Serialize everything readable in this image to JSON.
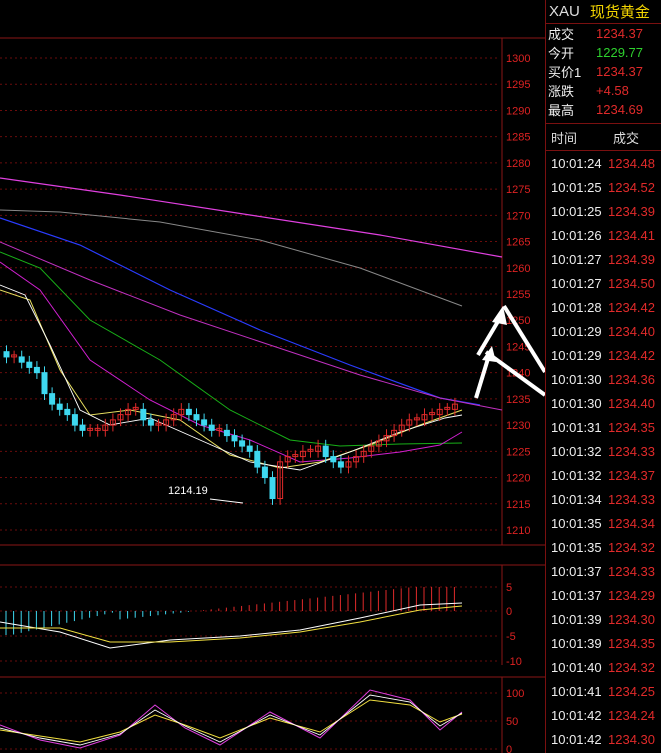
{
  "header": {
    "symbol": "XAU",
    "name": "现货黄金"
  },
  "quote": [
    {
      "label": "成交",
      "value": "1234.37",
      "color": "#e02a2a"
    },
    {
      "label": "今开",
      "value": "1229.77",
      "color": "#2ed12e"
    },
    {
      "label": "买价1",
      "value": "1234.37",
      "color": "#e02a2a"
    },
    {
      "label": "涨跌",
      "value": "+4.58",
      "color": "#e02a2a"
    },
    {
      "label": "最高",
      "value": "1234.69",
      "color": "#e02a2a"
    }
  ],
  "ticks_header": {
    "time": "时间",
    "price": "成交"
  },
  "ticks": [
    {
      "time": "10:01:24",
      "price": "1234.48"
    },
    {
      "time": "10:01:25",
      "price": "1234.52"
    },
    {
      "time": "10:01:25",
      "price": "1234.39"
    },
    {
      "time": "10:01:26",
      "price": "1234.41"
    },
    {
      "time": "10:01:27",
      "price": "1234.39"
    },
    {
      "time": "10:01:27",
      "price": "1234.50"
    },
    {
      "time": "10:01:28",
      "price": "1234.42"
    },
    {
      "time": "10:01:29",
      "price": "1234.40"
    },
    {
      "time": "10:01:29",
      "price": "1234.42"
    },
    {
      "time": "10:01:30",
      "price": "1234.36"
    },
    {
      "time": "10:01:30",
      "price": "1234.40"
    },
    {
      "time": "10:01:31",
      "price": "1234.35"
    },
    {
      "time": "10:01:32",
      "price": "1234.33"
    },
    {
      "time": "10:01:32",
      "price": "1234.37"
    },
    {
      "time": "10:01:34",
      "price": "1234.33"
    },
    {
      "time": "10:01:35",
      "price": "1234.34"
    },
    {
      "time": "10:01:35",
      "price": "1234.32"
    },
    {
      "time": "10:01:37",
      "price": "1234.33"
    },
    {
      "time": "10:01:37",
      "price": "1234.29"
    },
    {
      "time": "10:01:39",
      "price": "1234.30"
    },
    {
      "time": "10:01:39",
      "price": "1234.35"
    },
    {
      "time": "10:01:40",
      "price": "1234.32"
    },
    {
      "time": "10:01:41",
      "price": "1234.25"
    },
    {
      "time": "10:01:42",
      "price": "1234.24"
    },
    {
      "time": "10:01:42",
      "price": "1234.30"
    }
  ],
  "main_axis": {
    "labels": [
      "1300",
      "1295",
      "1290",
      "1285",
      "1280",
      "1275",
      "1270",
      "1265",
      "1260",
      "1255",
      "1250",
      "1245",
      "1240",
      "1235",
      "1230",
      "1225",
      "1220",
      "1215",
      "1210"
    ]
  },
  "macd_axis": {
    "labels": [
      "5",
      "0",
      "-5",
      "-10"
    ]
  },
  "kdj_axis": {
    "labels": [
      "100",
      "50",
      "0"
    ]
  },
  "low_annotation": "1214.19",
  "colors": {
    "up": "#e02a2a",
    "down": "#3fd8f0",
    "grid": "#6a0c0c",
    "border": "#8a1616"
  }
}
